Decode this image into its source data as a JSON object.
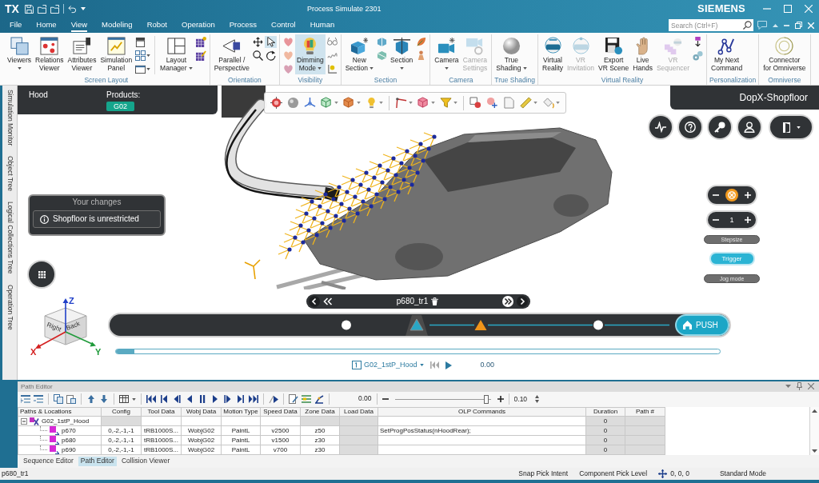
{
  "title_bar": {
    "logo": "TX",
    "title": "Process Simulate 2301",
    "brand": "SIEMENS"
  },
  "menu_tabs": [
    {
      "label": "File",
      "selected": false
    },
    {
      "label": "Home",
      "selected": false
    },
    {
      "label": "View",
      "selected": true
    },
    {
      "label": "Modeling",
      "selected": false
    },
    {
      "label": "Robot",
      "selected": false
    },
    {
      "label": "Operation",
      "selected": false
    },
    {
      "label": "Process",
      "selected": false
    },
    {
      "label": "Control",
      "selected": false
    },
    {
      "label": "Human",
      "selected": false
    }
  ],
  "search": {
    "placeholder": "Search (Ctrl+F)"
  },
  "ribbon_groups": [
    {
      "label": "Screen Layout",
      "items": [
        {
          "kind": "large",
          "label": "Viewers",
          "caret": true,
          "pressed": false,
          "disabled": false
        },
        {
          "kind": "large",
          "label": "Relations\nViewer",
          "caret": false,
          "pressed": false,
          "disabled": false
        },
        {
          "kind": "large",
          "label": "Attributes\nViewer",
          "caret": false,
          "pressed": false,
          "disabled": false
        },
        {
          "kind": "large",
          "label": "Simulation\nPanel",
          "caret": false,
          "pressed": false,
          "disabled": false
        },
        {
          "kind": "stack",
          "items": [
            {
              "caret": false,
              "pressed": false
            },
            {
              "caret": true,
              "pressed": false
            },
            {
              "caret": true,
              "pressed": false
            }
          ]
        },
        {
          "kind": "divider"
        },
        {
          "kind": "large",
          "label": "Layout\nManager",
          "caret": true,
          "pressed": false,
          "disabled": false
        },
        {
          "kind": "stack",
          "items": [
            {
              "caret": false,
              "pressed": false
            },
            {
              "caret": false,
              "pressed": false
            }
          ]
        }
      ]
    },
    {
      "label": "Orientation",
      "items": [
        {
          "kind": "large",
          "label": "Parallel /\nPerspective",
          "caret": false,
          "pressed": false,
          "disabled": false
        },
        {
          "kind": "stack",
          "items": [
            {
              "caret": false,
              "pressed": false
            },
            {
              "caret": false,
              "pressed": false
            }
          ]
        },
        {
          "kind": "stack",
          "items": [
            {
              "caret": false,
              "pressed": true
            },
            {
              "caret": false,
              "pressed": false
            }
          ]
        }
      ]
    },
    {
      "label": "Visibility",
      "items": [
        {
          "kind": "stack",
          "items": [
            {
              "caret": false,
              "pressed": false
            },
            {
              "caret": false,
              "pressed": false
            },
            {
              "caret": false,
              "pressed": false
            }
          ]
        },
        {
          "kind": "large",
          "label": "Dimming\nMode",
          "caret": true,
          "pressed": true,
          "disabled": false
        },
        {
          "kind": "stack",
          "items": [
            {
              "caret": false,
              "pressed": false
            },
            {
              "caret": false,
              "pressed": false
            },
            {
              "caret": false,
              "pressed": false
            }
          ]
        }
      ]
    },
    {
      "label": "Section",
      "items": [
        {
          "kind": "large",
          "label": "New\nSection",
          "caret": true,
          "pressed": false,
          "disabled": false
        },
        {
          "kind": "stack",
          "items": [
            {
              "caret": false,
              "pressed": false
            },
            {
              "caret": false,
              "pressed": false
            }
          ]
        },
        {
          "kind": "large",
          "label": "Section",
          "caret": true,
          "pressed": false,
          "disabled": false
        },
        {
          "kind": "stack",
          "items": [
            {
              "caret": false,
              "pressed": false
            },
            {
              "caret": false,
              "pressed": false
            }
          ]
        }
      ]
    },
    {
      "label": "Camera",
      "items": [
        {
          "kind": "large",
          "label": "Camera",
          "caret": true,
          "pressed": false,
          "disabled": false
        },
        {
          "kind": "large",
          "label": "Camera\nSettings",
          "caret": false,
          "pressed": false,
          "disabled": true
        }
      ]
    },
    {
      "label": "True Shading",
      "items": [
        {
          "kind": "large",
          "label": "True\nShading",
          "caret": true,
          "pressed": false,
          "disabled": false
        }
      ]
    },
    {
      "label": "Virtual Reality",
      "items": [
        {
          "kind": "large",
          "label": "Virtual\nReality",
          "caret": false,
          "pressed": false,
          "disabled": false
        },
        {
          "kind": "large",
          "label": "VR\nInvitation",
          "caret": false,
          "pressed": false,
          "disabled": true
        },
        {
          "kind": "large",
          "label": "Export\nVR Scene",
          "caret": false,
          "pressed": false,
          "disabled": false
        },
        {
          "kind": "large",
          "label": "Live\nHands",
          "caret": false,
          "pressed": false,
          "disabled": false
        },
        {
          "kind": "large",
          "label": "VR\nSequencer",
          "caret": false,
          "pressed": false,
          "disabled": true
        },
        {
          "kind": "stack",
          "items": [
            {
              "caret": false,
              "pressed": false
            },
            {
              "caret": false,
              "pressed": false
            }
          ]
        }
      ]
    },
    {
      "label": "Personalization",
      "items": [
        {
          "kind": "large",
          "label": "My Next\nCommand",
          "caret": false,
          "pressed": false,
          "disabled": false
        }
      ]
    },
    {
      "label": "Omniverse",
      "items": [
        {
          "kind": "large",
          "label": "Connector\nfor Omniverse",
          "caret": false,
          "pressed": false,
          "disabled": false
        }
      ]
    }
  ],
  "side_tabs": [
    "Simulation Monitor",
    "Object Tree",
    "Logical Collections Tree",
    "Operation Tree"
  ],
  "viewport": {
    "product_panel": {
      "name": "Hood",
      "products_label": "Products:",
      "product": "G02"
    },
    "shopfloor": "DopX-Shopfloor",
    "changes_panel": {
      "title": "Your changes",
      "message": "Shopfloor is unrestricted"
    },
    "jog": {
      "step": "1",
      "modes": [
        {
          "label": "Stepsize",
          "selected": false
        },
        {
          "label": "Trigger",
          "selected": true
        },
        {
          "label": "Jog mode",
          "selected": false
        }
      ]
    },
    "location": "p680_tr1",
    "push_label": "PUSH",
    "progress": {
      "level": 0.03
    },
    "operation": {
      "name": "G02_1stP_Hood",
      "time": "0.00"
    },
    "view_cube": {
      "axes": [
        {
          "label": "Z",
          "color": "#2140c8"
        },
        {
          "label": "X",
          "color": "#d42020"
        },
        {
          "label": "Y",
          "color": "#1f9a3a"
        }
      ],
      "faces": [
        "Right",
        "Back"
      ]
    }
  },
  "path_editor": {
    "title": "Path Editor",
    "time": "0.00",
    "speed_slider": {
      "level": 0.95
    },
    "step": "0.10",
    "tree_column": "Paths & Locations",
    "columns": [
      "Config",
      "Tool Data",
      "Wobj Data",
      "Motion Type",
      "Speed Data",
      "Zone Data",
      "Load Data",
      "OLP Commands",
      "Duration",
      "Path #"
    ],
    "rows": [
      {
        "label": "G02_1stP_Hood",
        "expanded": true,
        "cells": [
          {
            "shaded": true
          },
          {
            "shaded": false
          },
          {
            "shaded": false
          },
          {
            "shaded": false
          },
          {
            "shaded": false
          },
          {
            "shaded": true
          },
          {
            "shaded": true
          },
          {
            "shaded": false
          },
          {
            "text": "0",
            "shaded": true
          },
          {
            "shaded": true
          }
        ],
        "children": [
          {
            "label": "p670",
            "cells": [
              {
                "text": "0,-2,-1,-1",
                "shaded": false
              },
              {
                "text": "tRB1000S...",
                "shaded": false
              },
              {
                "text": "WobjG02",
                "shaded": false
              },
              {
                "text": "PaintL",
                "shaded": false
              },
              {
                "text": "v2500",
                "shaded": false
              },
              {
                "text": "z50",
                "shaded": false
              },
              {
                "shaded": true
              },
              {
                "text": "SetProgPosStatus(nHoodRear);",
                "shaded": false
              },
              {
                "text": "0",
                "shaded": true
              },
              {
                "shaded": true
              }
            ]
          },
          {
            "label": "p680",
            "cells": [
              {
                "text": "0,-2,-1,-1",
                "shaded": false
              },
              {
                "text": "tRB1000S...",
                "shaded": false
              },
              {
                "text": "WobjG02",
                "shaded": false
              },
              {
                "text": "PaintL",
                "shaded": false
              },
              {
                "text": "v1500",
                "shaded": false
              },
              {
                "text": "z30",
                "shaded": false
              },
              {
                "shaded": true
              },
              {
                "shaded": false
              },
              {
                "text": "0",
                "shaded": true
              },
              {
                "shaded": true
              }
            ]
          },
          {
            "label": "p690",
            "cells": [
              {
                "text": "0,-2,-1,-1",
                "shaded": false
              },
              {
                "text": "tRB1000S...",
                "shaded": false
              },
              {
                "text": "WobjG02",
                "shaded": false
              },
              {
                "text": "PaintL",
                "shaded": false
              },
              {
                "text": "v700",
                "shaded": false
              },
              {
                "text": "z30",
                "shaded": false
              },
              {
                "shaded": true
              },
              {
                "shaded": false
              },
              {
                "text": "0",
                "shaded": true
              },
              {
                "shaded": true
              }
            ]
          }
        ]
      }
    ],
    "tabs": [
      {
        "label": "Sequence Editor",
        "selected": false
      },
      {
        "label": "Path Editor",
        "selected": true
      },
      {
        "label": "Collision Viewer",
        "selected": false
      }
    ]
  },
  "status_bar": {
    "selection": "p680_tr1",
    "items": [
      "Snap Pick Intent",
      "Component Pick Level"
    ],
    "coordinates": "0, 0, 0",
    "mode": "Standard Mode"
  }
}
